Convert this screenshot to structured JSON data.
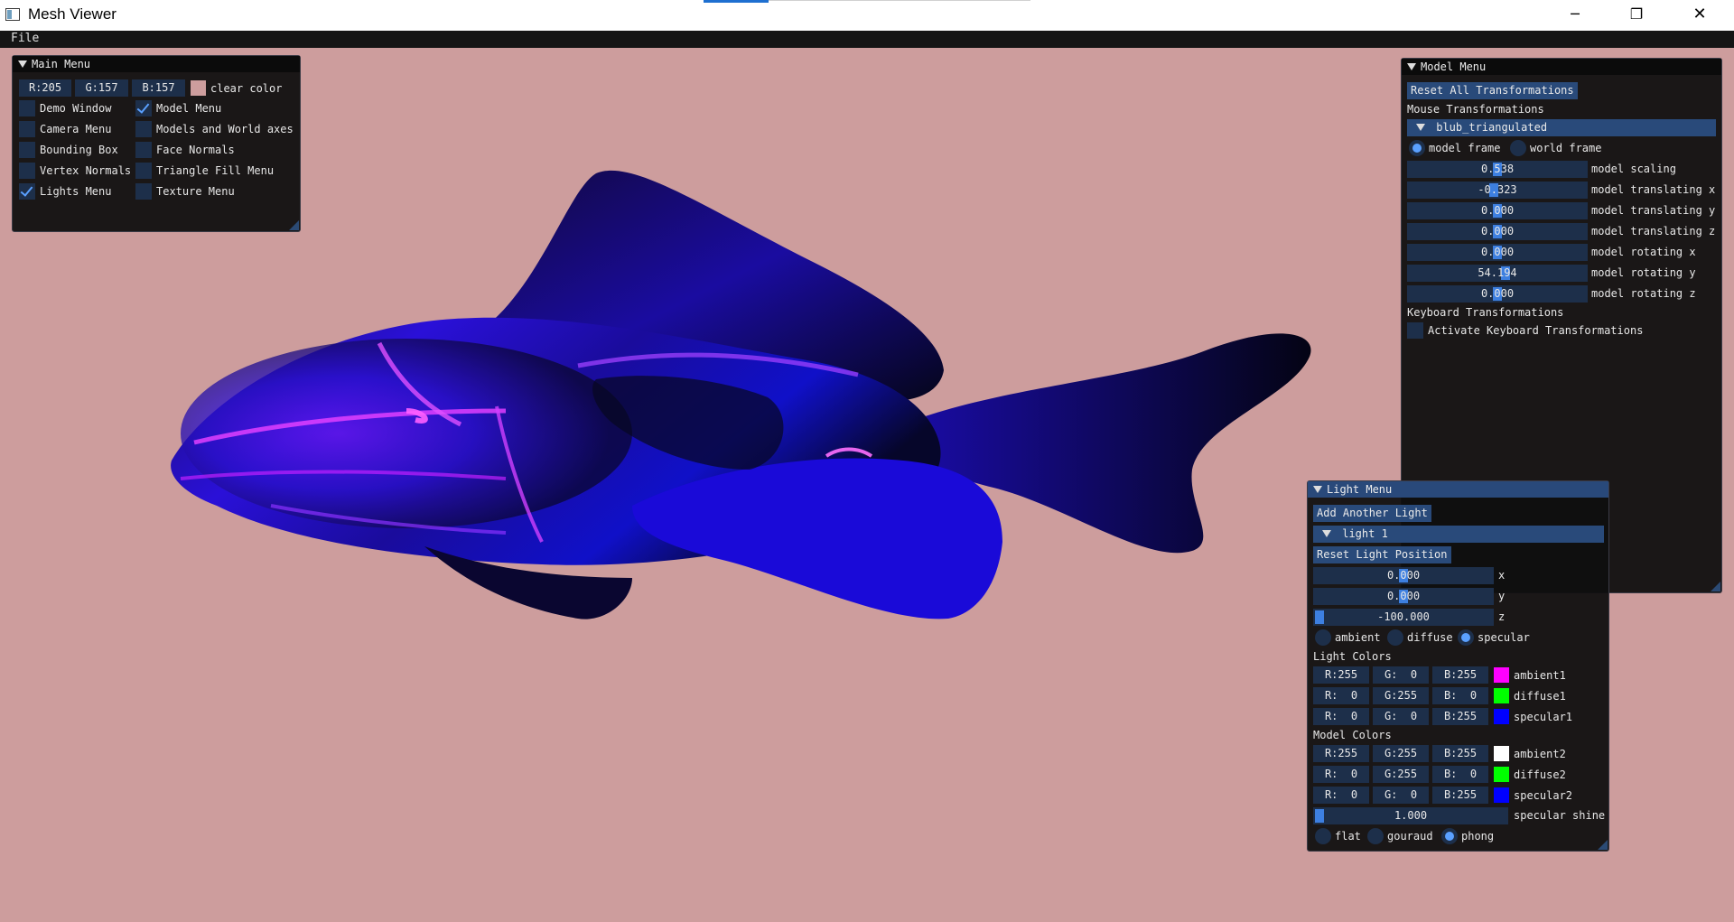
{
  "window": {
    "title": "Mesh Viewer",
    "minimize_glyph": "─",
    "restore_glyph": "❐",
    "close_glyph": "✕"
  },
  "menubar": {
    "file": "File"
  },
  "colors": {
    "background": "#cd9d9d",
    "imgui_title_active": "#294a7a",
    "widget_bg": "#1d2f4a",
    "accent": "#5aa0ff"
  },
  "main_menu": {
    "title": "Main Menu",
    "color_r": "R:205",
    "color_g": "G:157",
    "color_b": "B:157",
    "clear_color_label": "clear color",
    "swatch": "#cd9d9d",
    "checkboxes": [
      {
        "label": "Demo Window",
        "checked": false
      },
      {
        "label": "Model Menu",
        "checked": true
      },
      {
        "label": "Camera Menu",
        "checked": false
      },
      {
        "label": "Models and World axes",
        "checked": false
      },
      {
        "label": "Bounding Box",
        "checked": false
      },
      {
        "label": "Face Normals",
        "checked": false
      },
      {
        "label": "Vertex Normals",
        "checked": false
      },
      {
        "label": "Triangle Fill Menu",
        "checked": false
      },
      {
        "label": "Lights Menu",
        "checked": true
      },
      {
        "label": "Texture Menu",
        "checked": false
      }
    ]
  },
  "model_menu": {
    "title": "Model Menu",
    "reset_button": "Reset All Transformations",
    "mouse_section": "Mouse Transformations",
    "model_header": "blub_triangulated",
    "frame_model": "model frame",
    "frame_world": "world frame",
    "frame_selected": "model frame",
    "sliders": [
      {
        "value": "0.538",
        "label": "model scaling",
        "fraction": 0.5
      },
      {
        "value": "-0.323",
        "label": "model translating x",
        "fraction": 0.47
      },
      {
        "value": "0.000",
        "label": "model translating y",
        "fraction": 0.5
      },
      {
        "value": "0.000",
        "label": "model translating z",
        "fraction": 0.5
      },
      {
        "value": "0.000",
        "label": "model rotating x",
        "fraction": 0.5
      },
      {
        "value": "54.194",
        "label": "model rotating y",
        "fraction": 0.5
      },
      {
        "value": "0.000",
        "label": "model rotating z",
        "fraction": 0.5
      }
    ],
    "keyboard_section": "Keyboard Transformations",
    "keyboard_checkbox": "Activate Keyboard Transformations",
    "keyboard_checked": false
  },
  "light_menu": {
    "title": "Light Menu",
    "add_button": "Add Another Light",
    "light_header": "light 1",
    "reset_button": "Reset Light Position",
    "position": [
      {
        "value": "0.000",
        "label": "x",
        "fraction": 0.5
      },
      {
        "value": "0.000",
        "label": "y",
        "fraction": 0.5
      },
      {
        "value": "-100.000",
        "label": "z",
        "fraction": 0.0
      }
    ],
    "modes": [
      "ambient",
      "diffuse",
      "specular"
    ],
    "mode_selected": "specular",
    "light_colors_title": "Light Colors",
    "light_colors": [
      {
        "r": "R:255",
        "g": "G:  0",
        "b": "B:255",
        "swatch": "#ff00ff",
        "label": "ambient1"
      },
      {
        "r": "R:  0",
        "g": "G:255",
        "b": "B:  0",
        "swatch": "#00ff00",
        "label": "diffuse1"
      },
      {
        "r": "R:  0",
        "g": "G:  0",
        "b": "B:255",
        "swatch": "#0000ff",
        "label": "specular1"
      }
    ],
    "model_colors_title": "Model Colors",
    "model_colors": [
      {
        "r": "R:255",
        "g": "G:255",
        "b": "B:255",
        "swatch": "#ffffff",
        "label": "ambient2"
      },
      {
        "r": "R:  0",
        "g": "G:255",
        "b": "B:  0",
        "swatch": "#00ff00",
        "label": "diffuse2"
      },
      {
        "r": "R:  0",
        "g": "G:  0",
        "b": "B:255",
        "swatch": "#0000ff",
        "label": "specular2"
      }
    ],
    "shine_value": "1.000",
    "shine_label": "specular shine",
    "shine_fraction": 0.0,
    "shading": [
      "flat",
      "gouraud",
      "phong"
    ],
    "shading_selected": "phong"
  }
}
